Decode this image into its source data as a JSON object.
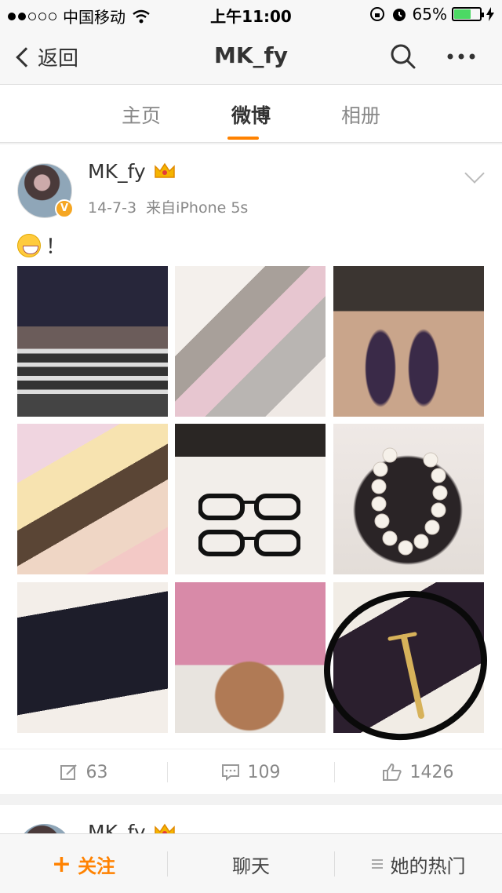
{
  "status_bar": {
    "carrier": "中国移动",
    "time": "上午11:00",
    "battery_percent": "65%",
    "battery_level": 0.65
  },
  "nav": {
    "back_label": "返回",
    "title": "MK_fy",
    "icons": [
      "search-icon",
      "more-icon"
    ]
  },
  "tabs": [
    {
      "label": "主页",
      "active": false
    },
    {
      "label": "微博",
      "active": true
    },
    {
      "label": "相册",
      "active": false
    }
  ],
  "post": {
    "author": "MK_fy",
    "date": "14-7-3",
    "source": "来自iPhone 5s",
    "text": "！",
    "photo_count": 9,
    "reposts": "63",
    "comments": "109",
    "likes": "1426"
  },
  "post2": {
    "author": "MK_fy"
  },
  "toolbar": {
    "follow_plus": "+",
    "follow_label": "关注",
    "chat_label": "聊天",
    "hot_label": "她的热门"
  },
  "colors": {
    "accent": "#ff8200",
    "battery": "#4cd964"
  }
}
